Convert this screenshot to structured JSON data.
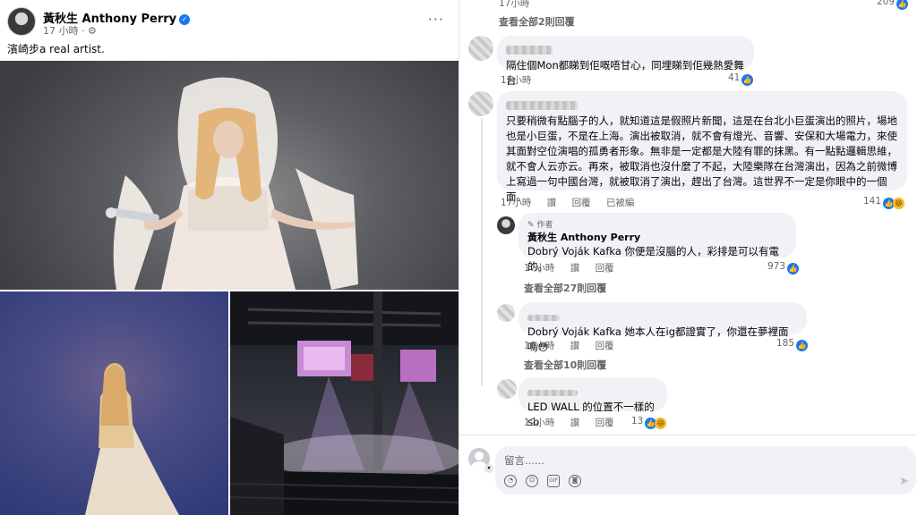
{
  "post": {
    "author": "黃秋生 Anthony Perry",
    "time": "17 小時",
    "privacy_icon": "gear-icon",
    "more": "···",
    "caption": "濱崎步a real artist."
  },
  "comments_panel": {
    "top_count": "209",
    "view_more_1": "查看全部2則回覆",
    "c1": {
      "text": "隔住個Mon都睇到佢嘅唔甘心，同埋睇到佢幾熱愛舞台",
      "time": "17小時",
      "reactions": "41"
    },
    "c2": {
      "text": "只要稍微有點腦子的人，就知道這是假照片新聞，這是在台北小巨蛋演出的照片，場地也是小巨蛋，不是在上海。演出被取消，就不會有燈光、音響、安保和大場電力，來使其面對空位演唱的孤勇者形象。無非是一定都是大陸有罪的抹黑。有一點點邏輯思維，就不會人云亦云。再來，被取消也沒什麼了不起，大陸樂隊在台灣演出，因為之前微博上寫過一句中國台灣，就被取消了演出，趕出了台灣。這世界不一定是你眼中的一個面。",
      "time": "17小時",
      "reply": "讚",
      "reply2": "回覆",
      "translate": "已被編",
      "reactions": "141"
    },
    "r1": {
      "author_tag": "作者",
      "name": "黃秋生 Anthony Perry",
      "text": "Dobrý Voják Kafka 你便是沒腦的人，彩排是可以有電的。",
      "time": "17小時",
      "like": "讚",
      "reply": "回覆",
      "reactions": "973"
    },
    "view_more_2": "查看全部27則回覆",
    "r2": {
      "text": "Dobrý Voják Kafka 她本人在ig都證實了，你還在夢裡面嗎😳",
      "time": "16小時",
      "like": "讚",
      "reply": "回覆",
      "reactions": "185"
    },
    "view_more_3": "查看全部10則回覆",
    "c3": {
      "text": "LED WALL 的位置不一樣的 sb",
      "time": "12小時",
      "like": "讚",
      "reply": "回覆",
      "reactions": "13"
    },
    "composer": {
      "placeholder": "留言......",
      "icons": [
        "sticker-icon",
        "emoji-icon",
        "gif-icon",
        "camera-icon"
      ],
      "send": "➤"
    }
  },
  "colors": {
    "facebook_blue": "#1877f2",
    "bubble_bg": "#f0f2f5",
    "secondary_text": "#65676b"
  }
}
